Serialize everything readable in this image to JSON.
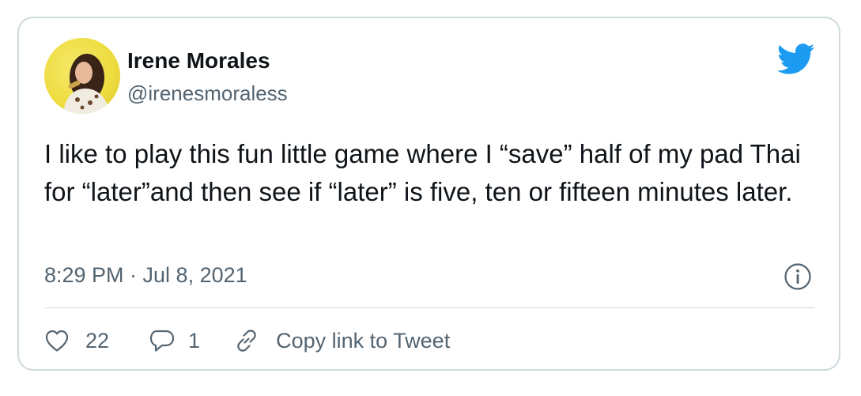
{
  "tweet": {
    "author": {
      "name": "Irene Morales",
      "handle": "@irenesmoraless"
    },
    "text": "I like to play this fun little game where I “save” half of my pad Thai for “later”and then see if “later” is five, ten or fifteen minutes later.",
    "timestamp": "8:29 PM · Jul 8, 2021",
    "actions": {
      "likes": "22",
      "replies": "1",
      "copy_link_label": "Copy link to Tweet"
    }
  },
  "icons": {
    "brand": "twitter-bird-icon",
    "info": "info-icon",
    "like": "heart-icon",
    "reply": "speech-bubble-icon",
    "link": "link-icon"
  },
  "colors": {
    "brand_blue": "#1d9bf0",
    "text_primary": "#0f1419",
    "text_secondary": "#536471",
    "border": "#cfd9de",
    "avatar_background": "#eedc3f"
  }
}
